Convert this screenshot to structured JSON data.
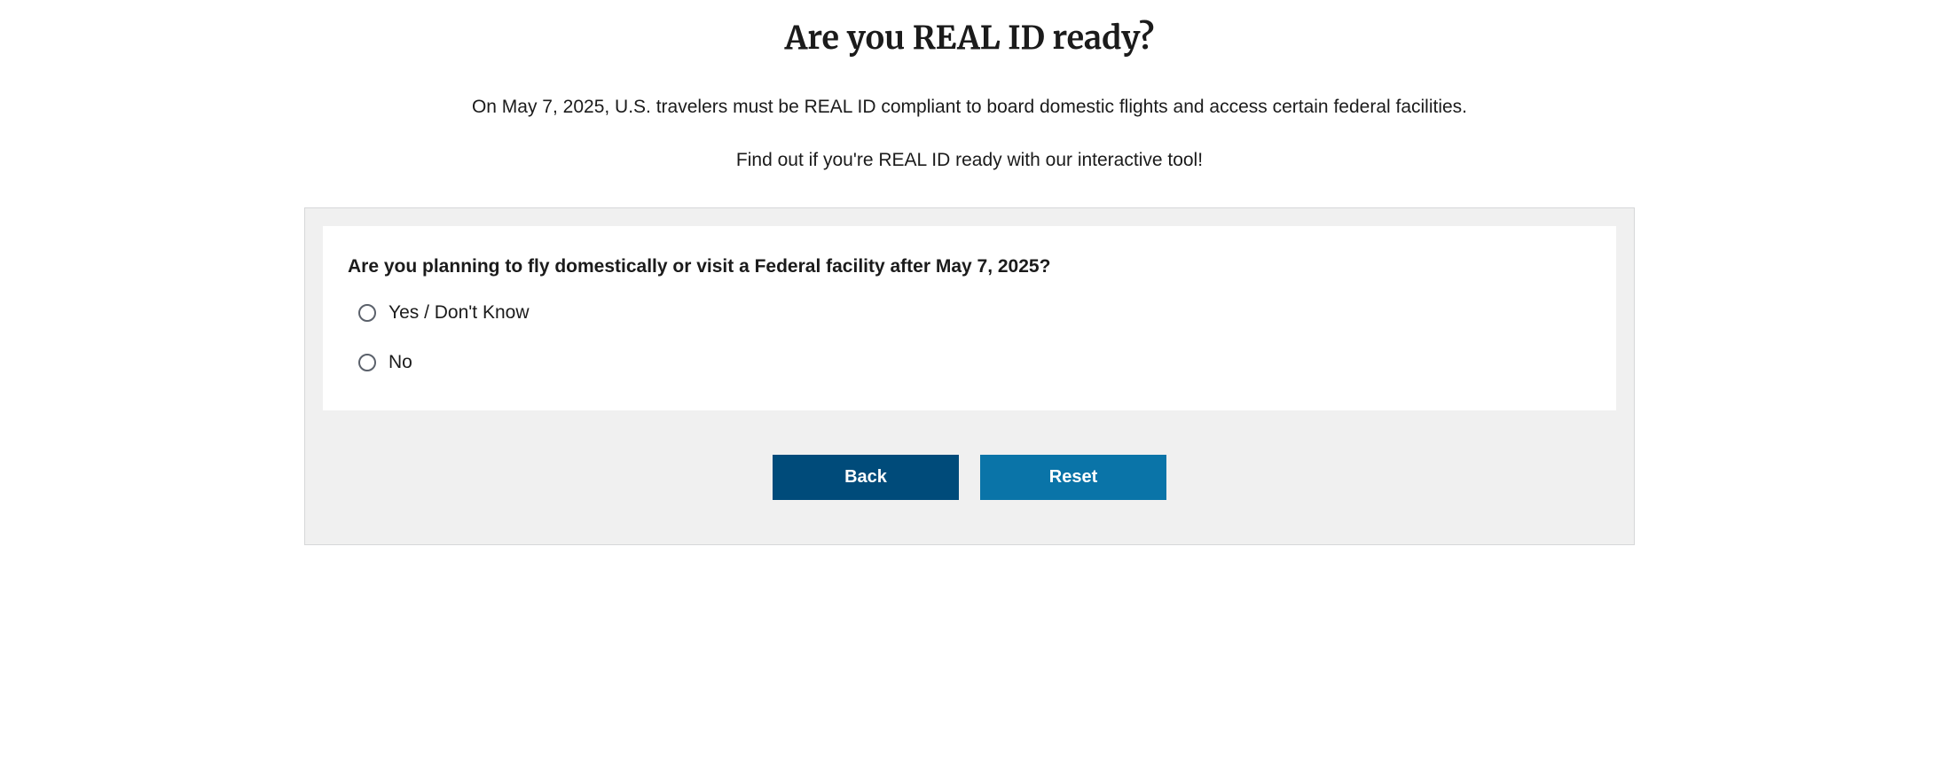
{
  "header": {
    "title": "Are you REAL ID ready?",
    "intro": "On May 7, 2025, U.S. travelers must be REAL ID compliant to board domestic flights and access certain federal facilities.",
    "subintro": "Find out if you're REAL ID ready with our interactive tool!"
  },
  "form": {
    "question": "Are you planning to fly domestically or visit a Federal facility after May 7, 2025?",
    "options": [
      {
        "label": "Yes / Don't Know"
      },
      {
        "label": "No"
      }
    ],
    "buttons": {
      "back": "Back",
      "reset": "Reset"
    }
  }
}
